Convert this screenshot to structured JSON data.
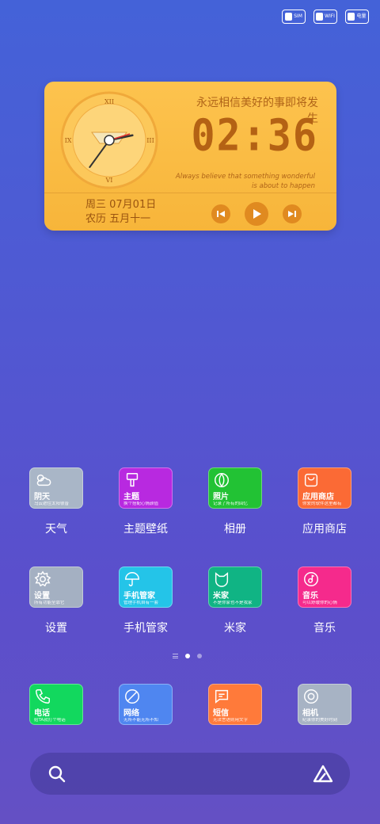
{
  "status_bar": [
    {
      "icon": "sim-icon",
      "label": "SIM"
    },
    {
      "icon": "wifi-icon",
      "label": "WIFI"
    },
    {
      "icon": "battery-icon",
      "label": "电量"
    }
  ],
  "clock_widget": {
    "motto": "永远相信美好的事即将发生",
    "time": "02:36",
    "tagline_line1": "Always believe that something wonderful",
    "tagline_line2": "is about to happen",
    "weekday_date": "周三 07月01日",
    "lunar_date": "农历 五月十一",
    "analog": {
      "numerals": [
        "XII",
        "III",
        "VI",
        "IX"
      ],
      "hour": 2,
      "minute": 36
    }
  },
  "apps": [
    {
      "label": "天气",
      "tile_title": "阴天",
      "tile_sub": "乌云遮住太阳很普",
      "icon": "cloud-sun-icon",
      "color": "#a9b6c7"
    },
    {
      "label": "主题壁纸",
      "tile_title": "主题",
      "tile_sub": "换个搭配心情颜值",
      "icon": "paintbrush-icon",
      "color": "#b829e0"
    },
    {
      "label": "相册",
      "tile_title": "照片",
      "tile_sub": "记录了所有的回忆",
      "icon": "flower-icon",
      "color": "#22c234"
    },
    {
      "label": "应用商店",
      "tile_title": "应用商店",
      "tile_sub": "你爱的软件这里都有",
      "icon": "shopping-bag-icon",
      "color": "#fb6a35"
    },
    {
      "label": "设置",
      "tile_title": "设置",
      "tile_sub": "所有功能全靠它",
      "icon": "gear-icon",
      "color": "#a4b0c2"
    },
    {
      "label": "手机管家",
      "tile_title": "手机管家",
      "tile_sub": "管理手机自有一套",
      "icon": "umbrella-icon",
      "color": "#24c4e8"
    },
    {
      "label": "米家",
      "tile_title": "米家",
      "tile_sub": "不是你家也不是我家",
      "icon": "mijia-cat-icon",
      "color": "#10b484"
    },
    {
      "label": "音乐",
      "tile_title": "音乐",
      "tile_sub": "可以舒缓你的心情",
      "icon": "music-note-icon",
      "color": "#f52a8c"
    }
  ],
  "dock": [
    {
      "tile_title": "电话",
      "tile_sub": "给TA就打个电话",
      "icon": "phone-icon",
      "color": "#12d85e"
    },
    {
      "tile_title": "网络",
      "tile_sub": "无所不能无所不知",
      "icon": "browser-icon",
      "color": "#4f86f0"
    },
    {
      "tile_title": "短信",
      "tile_sub": "无法言语则用文字",
      "icon": "message-icon",
      "color": "#ff7a3a"
    },
    {
      "tile_title": "相机",
      "tile_sub": "纪录你的美好时刻",
      "icon": "camera-icon",
      "color": "#a7b3c4"
    }
  ],
  "pager": {
    "pages": 2,
    "active": 1
  },
  "search": {
    "icon": "search-icon",
    "assistant_icon": "assistant-icon"
  }
}
